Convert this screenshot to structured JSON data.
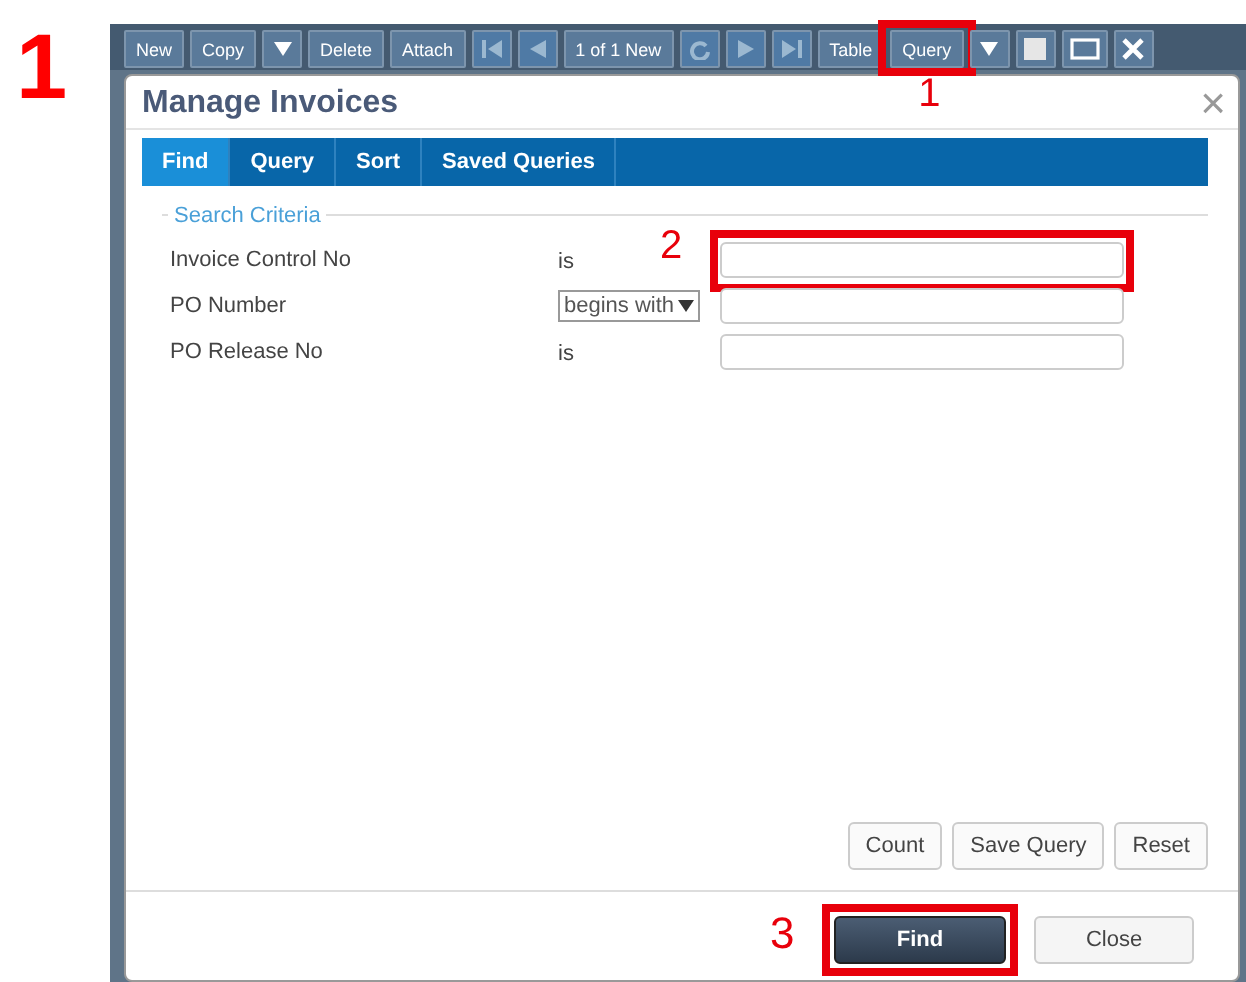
{
  "step_label": "1",
  "toolbar": [
    {
      "kind": "text",
      "label": "New",
      "disabled": false
    },
    {
      "kind": "text",
      "label": "Copy",
      "disabled": false
    },
    {
      "kind": "caret",
      "disabled": false
    },
    {
      "kind": "text",
      "label": "Delete",
      "disabled": false
    },
    {
      "kind": "text",
      "label": "Attach",
      "disabled": false
    },
    {
      "kind": "first",
      "disabled": true
    },
    {
      "kind": "prev",
      "disabled": true
    },
    {
      "kind": "text",
      "label": "1 of 1 New",
      "disabled": false
    },
    {
      "kind": "refresh",
      "disabled": true
    },
    {
      "kind": "next",
      "disabled": true
    },
    {
      "kind": "last",
      "disabled": true
    },
    {
      "kind": "text",
      "label": "Table",
      "disabled": false
    },
    {
      "kind": "text",
      "label": "Query",
      "disabled": false,
      "callout": "1"
    },
    {
      "kind": "caret",
      "disabled": false
    },
    {
      "kind": "square",
      "disabled": false
    },
    {
      "kind": "window",
      "disabled": false
    },
    {
      "kind": "close",
      "disabled": false
    }
  ],
  "dialog": {
    "title": "Manage Invoices",
    "close": "×"
  },
  "tabs": [
    {
      "label": "Find",
      "selected": true
    },
    {
      "label": "Query",
      "selected": false
    },
    {
      "label": "Sort",
      "selected": false
    },
    {
      "label": "Saved Queries",
      "selected": false
    }
  ],
  "criteria": {
    "legend": "Search Criteria",
    "rows": [
      {
        "label": "Invoice Control No",
        "operator": {
          "kind": "text",
          "text": "is"
        },
        "callout": "2"
      },
      {
        "label": "PO Number",
        "operator": {
          "kind": "select",
          "text": "begins with"
        }
      },
      {
        "label": "PO Release No",
        "operator": {
          "kind": "text",
          "text": "is"
        }
      }
    ]
  },
  "actions": [
    "Count",
    "Save Query",
    "Reset"
  ],
  "footer": [
    {
      "label": "Find",
      "kind": "primary",
      "callout": "3"
    },
    {
      "label": "Close",
      "kind": "secondary"
    }
  ]
}
